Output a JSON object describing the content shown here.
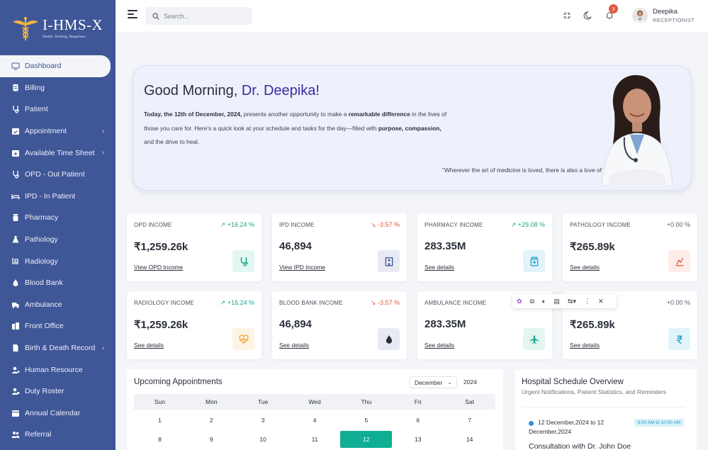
{
  "brand": {
    "title": "I-HMS-X",
    "tagline": "Health. Healing. Happiness"
  },
  "sidebar": {
    "items": [
      {
        "label": "Dashboard",
        "icon": "monitor-icon",
        "active": true,
        "submenu": false
      },
      {
        "label": "Billing",
        "icon": "receipt-icon",
        "submenu": false
      },
      {
        "label": "Patient",
        "icon": "stethoscope-icon",
        "submenu": false
      },
      {
        "label": "Appointment",
        "icon": "calendar-check-icon",
        "submenu": true
      },
      {
        "label": "Available Time Sheet",
        "icon": "calendar-plus-icon",
        "submenu": true
      },
      {
        "label": "OPD - Out Patient",
        "icon": "stethoscope-icon",
        "submenu": false
      },
      {
        "label": "IPD - In Patient",
        "icon": "bed-icon",
        "submenu": false
      },
      {
        "label": "Pharmacy",
        "icon": "pill-bottle-icon",
        "submenu": false
      },
      {
        "label": "Pathology",
        "icon": "flask-icon",
        "submenu": false
      },
      {
        "label": "Radiology",
        "icon": "xray-icon",
        "submenu": false
      },
      {
        "label": "Blood Bank",
        "icon": "blood-drop-icon",
        "submenu": false
      },
      {
        "label": "Ambulance",
        "icon": "ambulance-icon",
        "submenu": false
      },
      {
        "label": "Front Office",
        "icon": "building-icon",
        "submenu": false
      },
      {
        "label": "Birth & Death Record",
        "icon": "document-icon",
        "submenu": true
      },
      {
        "label": "Human Resource",
        "icon": "user-gear-icon",
        "submenu": false
      },
      {
        "label": "Duty Roster",
        "icon": "user-clock-icon",
        "submenu": false
      },
      {
        "label": "Annual Calendar",
        "icon": "calendar-icon",
        "submenu": false
      },
      {
        "label": "Referral",
        "icon": "users-icon",
        "submenu": false
      }
    ]
  },
  "header": {
    "search_placeholder": "Search...",
    "notification_count": "3",
    "user_name": "Deepika",
    "user_role": "RECEPTIONIST"
  },
  "hero": {
    "greeting": "Good Morning, ",
    "doctor_name": "Dr. Deepika!",
    "intro_1": "Today, the 12th of December, 2024,",
    "intro_2": " presents another opportunity to make a ",
    "intro_3": "remarkable difference",
    "intro_4": " in the lives of those you care for. Here’s a quick look at your schedule and tasks for the day—filled with ",
    "intro_5": "purpose, compassion,",
    "intro_6": " and the drive to heal.",
    "quote": "\"Wherever the art of medicine is loved, there is also a love of humanity.\" – Hippocrates"
  },
  "income_cards": [
    {
      "label": "OPD INCOME",
      "change": "+16.24 %",
      "trend": "up",
      "value": "₹1,259.26k",
      "link": "View OPD Income",
      "icon": "stethoscope-icon",
      "color": "#1aa78c",
      "bg": "#e3f6f2"
    },
    {
      "label": "IPD INCOME",
      "change": "-3.57 %",
      "trend": "down",
      "value": "46,894",
      "link": "View IPD Income",
      "icon": "hospital-icon",
      "color": "#3f5697",
      "bg": "#e7eaf3"
    },
    {
      "label": "PHARMACY INCOME",
      "change": "+29.08 %",
      "trend": "up",
      "value": "283.35M",
      "link": "See details",
      "icon": "medicine-icon",
      "color": "#1f9bc7",
      "bg": "#e1f4fa"
    },
    {
      "label": "PATHOLOGY INCOME",
      "change": "+0.00 %",
      "trend": "flat",
      "value": "₹265.89k",
      "link": "See details",
      "icon": "lab-chart-icon",
      "color": "#e4573d",
      "bg": "#fdece8"
    },
    {
      "label": "RADIOLOGY INCOME",
      "change": "+16.24 %",
      "trend": "up",
      "value": "₹1,259.26k",
      "link": "See details",
      "icon": "heart-pulse-icon",
      "color": "#f0a22e",
      "bg": "#fef4e3"
    },
    {
      "label": "BLOOD BANK INCOME",
      "change": "-3.57 %",
      "trend": "down",
      "value": "46,894",
      "link": "See details",
      "icon": "blood-drop-icon",
      "color": "#2b2f3a",
      "bg": "#e7eaf3"
    },
    {
      "label": "AMBULANCE INCOME",
      "change": "",
      "trend": "up",
      "value": "283.35M",
      "link": "See details",
      "icon": "airplane-icon",
      "color": "#1aa78c",
      "bg": "#e3f6f2"
    },
    {
      "label": "",
      "change": "+0.00 %",
      "trend": "flat",
      "value": "₹265.89k",
      "link": "See details",
      "icon": "rupee-icon",
      "color": "#1f9bc7",
      "bg": "#e1f4fa"
    }
  ],
  "appointments": {
    "title": "Upcoming Appointments",
    "month": "December",
    "year": "2024",
    "days": [
      "Sun",
      "Mon",
      "Tue",
      "Wed",
      "Thu",
      "Fri",
      "Sat"
    ],
    "weeks": [
      [
        "1",
        "2",
        "3",
        "4",
        "5",
        "6",
        "7"
      ],
      [
        "8",
        "9",
        "10",
        "11",
        "12",
        "13",
        "14"
      ]
    ],
    "today": "12"
  },
  "schedule": {
    "title": "Hospital Schedule Overview",
    "subtitle": "Urgent Notifications, Patient Statistics, and Reminders",
    "item_date": "12 December,2024 to 12 December,2024",
    "item_time": "9:00 AM to 10:00 AM",
    "item_title": "Consultation with Dr. John Doe"
  }
}
